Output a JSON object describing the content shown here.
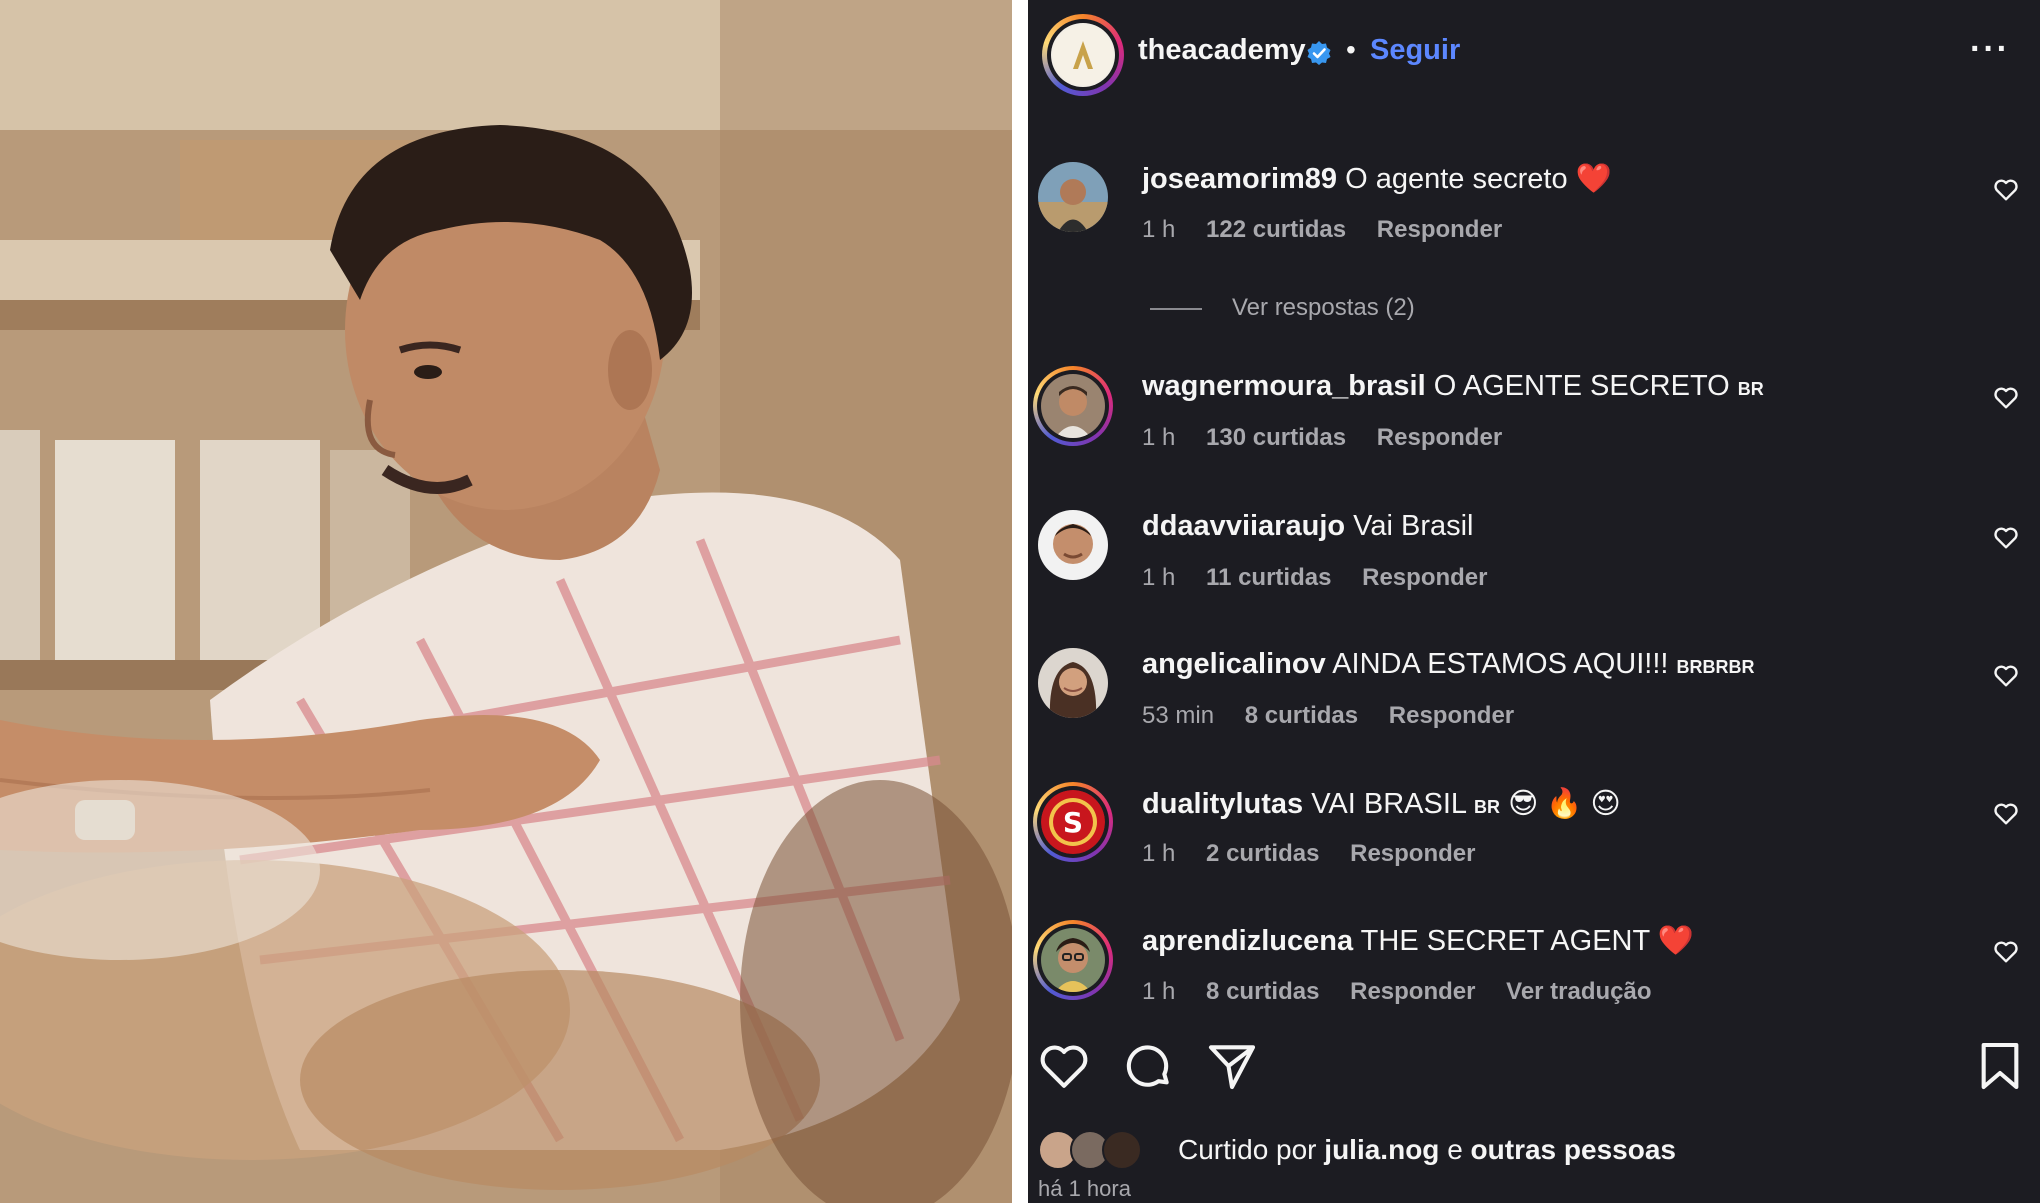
{
  "post": {
    "username": "theacademy",
    "separator": "•",
    "follow_label": "Seguir",
    "more_label": "···",
    "avatar_letter": "A"
  },
  "comments": [
    {
      "username": "joseamorim89",
      "text": "O agente secreto",
      "emoji": "❤️",
      "flag": "",
      "time": "1 h",
      "likes": "122 curtidas",
      "reply": "Responder",
      "extra": ""
    },
    {
      "username": "wagnermoura_brasil",
      "text": "O AGENTE SECRETO",
      "emoji": "",
      "flag": "BR",
      "time": "1 h",
      "likes": "130 curtidas",
      "reply": "Responder",
      "extra": ""
    },
    {
      "username": "ddaavviiaraujo",
      "text": "Vai Brasil",
      "emoji": "",
      "flag": "",
      "time": "1 h",
      "likes": "11 curtidas",
      "reply": "Responder",
      "extra": ""
    },
    {
      "username": "angelicalinov",
      "text": "AINDA ESTAMOS AQUI!!!",
      "emoji": "",
      "flag": "BRBRBR",
      "time": "53 min",
      "likes": "8 curtidas",
      "reply": "Responder",
      "extra": ""
    },
    {
      "username": "dualitylutas",
      "text": "VAI BRASIL",
      "emoji": "😎 🔥 😍",
      "flag": "BR",
      "time": "1 h",
      "likes": "2 curtidas",
      "reply": "Responder",
      "extra": ""
    },
    {
      "username": "aprendizlucena",
      "text": "THE SECRET AGENT",
      "emoji": "❤️",
      "flag": "",
      "time": "1 h",
      "likes": "8 curtidas",
      "reply": "Responder",
      "extra": "Ver tradução"
    }
  ],
  "view_replies": "Ver respostas (2)",
  "liked_by": {
    "prefix": "Curtido por",
    "user": "julia.nog",
    "connector": "e",
    "others": "outras pessoas"
  },
  "post_time": "há 1 hora",
  "colors": {
    "panel_bg": "#1c1c22",
    "link_blue": "#5c87ff",
    "verified_blue": "#3897f0",
    "heart_pink": "#ff3b7f"
  },
  "icons": [
    "verified-badge-icon",
    "more-options-icon",
    "heart-icon",
    "comment-icon",
    "share-icon",
    "bookmark-icon"
  ]
}
